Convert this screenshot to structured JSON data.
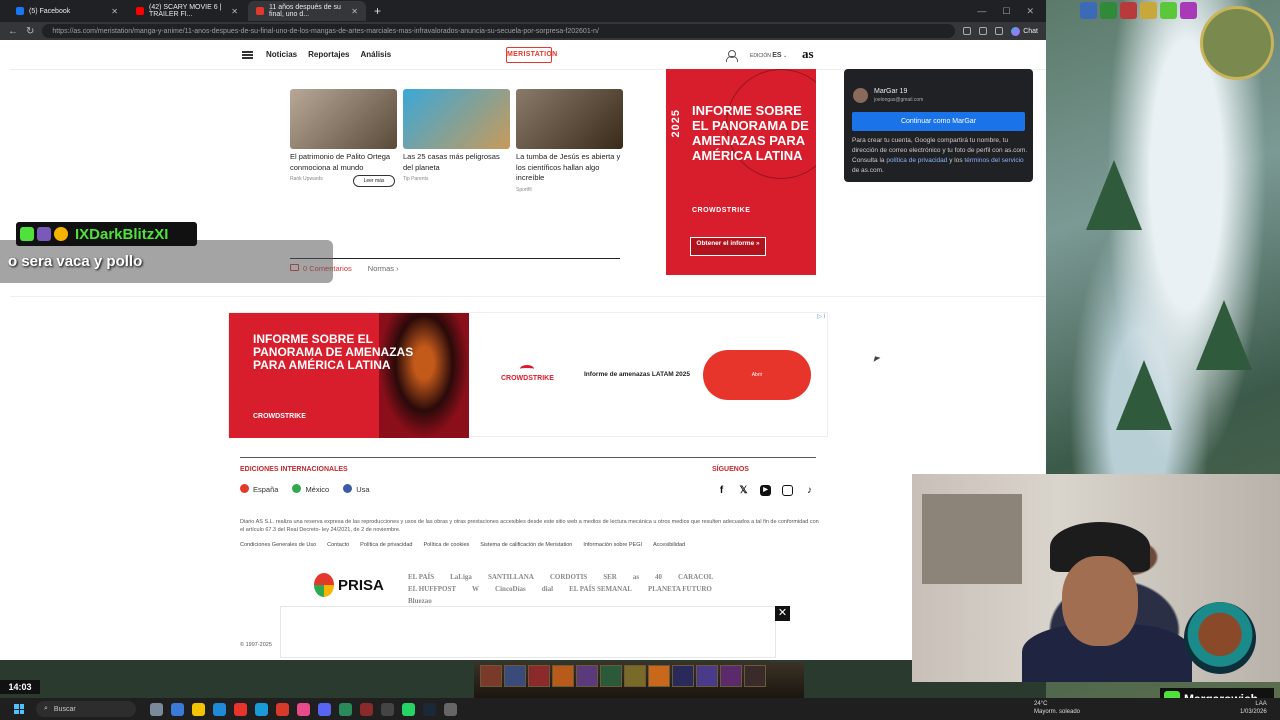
{
  "browser": {
    "tabs": [
      {
        "title": "(5) Facebook",
        "color": "#1877f2",
        "active": false
      },
      {
        "title": "(42) SCARY MOVIE 6 | TRAILER FI...",
        "color": "#ff0000",
        "active": false
      },
      {
        "title": "11 años después de su final, uno d...",
        "color": "#e4382b",
        "active": true
      }
    ],
    "new_tab": "+",
    "url": "https://as.com/meristation/manga-y-anime/11-anos-despues-de-su-final-uno-de-los-mangas-de-artes-marciales-mas-infravalorados-anuncia-su-secuela-por-sorpresa-f202601-n/",
    "copilot_label": "Chat"
  },
  "site": {
    "nav": [
      "Noticias",
      "Reportajes",
      "Análisis"
    ],
    "logo": "MERISTATION",
    "edition_label": "EDICIÓN",
    "edition_value": "ES",
    "as_logo": "as"
  },
  "related": [
    {
      "title": "El patrimonio de Palito Ortega conmociona al mundo",
      "source": "Rank Upwards",
      "img": "#8a7a6a"
    },
    {
      "title": "Las 25 casas más peligrosas del planeta",
      "source": "Tip Parents",
      "img": "#5aa8c8"
    },
    {
      "title": "La tumba de Jesús es abierta y los científicos hallan algo increíble",
      "source": "Sportfil",
      "img": "#7a6a5a"
    }
  ],
  "leer_mas": "Leer más",
  "comments": {
    "label": "0 Comentarios",
    "normas": "Normas ›"
  },
  "side_ad": {
    "year": "2025",
    "title": "INFORME SOBRE EL PANORAMA DE AMENAZAS PARA AMÉRICA LATINA",
    "brand": "CROWDSTRIKE",
    "button": "Obtener el informe »"
  },
  "google_onetap": {
    "name": "MarGar 19",
    "email": "joelongas@gmail.com",
    "continue": "Continuar como MarGar",
    "text_1": "Para crear tu cuenta, Google compartirá tu nombre, tu dirección de correo electrónico y tu foto de perfil con as.com. Consulta la ",
    "link_1": "política de privacidad",
    "text_2": " y los ",
    "link_2": "términos del servicio",
    "text_3": " de as.com."
  },
  "banner_ad": {
    "title": "INFORME SOBRE EL PANORAMA DE AMENAZAS PARA AMÉRICA LATINA",
    "brand": "CROWDSTRIKE",
    "mid_text": "Informe de amenazas LATAM 2025",
    "button": "Abrir",
    "adchoices": "▷ i"
  },
  "footer": {
    "ediciones_title": "EDICIONES INTERNACIONALES",
    "siguenos": "SÍGUENOS",
    "editions": [
      {
        "label": "España",
        "color": "#e4382b"
      },
      {
        "label": "México",
        "color": "#2fa84f"
      },
      {
        "label": "Usa",
        "color": "#3b5ba8"
      }
    ],
    "social": [
      "f",
      "𝕏",
      "▶",
      "◎",
      "♪"
    ],
    "legal": "Diario AS S.L. realiza una reserva expresa de las reproducciones y usos de las obras y otras prestaciones accesibles desde este sitio web a medios de lectura mecánica u otros medios que resulten adecuados a tal fin de conformidad con el artículo 67.3 del Real Decreto- ley 24/2021, de 2 de noviembre.",
    "links": [
      "Condiciones Generales de Uso",
      "Contacto",
      "Política de privacidad",
      "Política de cookies",
      "Sistema de calificación de Meristation",
      "Información sobre PEGI",
      "Accesibilidad"
    ],
    "prisa": "PRISA",
    "brands": [
      "EL PAÍS",
      "LaLiga",
      "SANTILLANA",
      "CORDOTIS",
      "SER",
      "as",
      "40",
      "CARACOL",
      "EL HUFFPOST",
      "W",
      "CincoDías",
      "dial",
      "EL PAÍS SEMANAL",
      "PLANETA FUTURO",
      "Bluezao"
    ],
    "copyright": "© 1997-2025"
  },
  "chat": {
    "username": "IXDarkBlitzXI",
    "message": "o sera vaca y pollo"
  },
  "streamer": {
    "name": "Margarowich"
  },
  "taskbar": {
    "search": "Buscar",
    "time_overlay": "14:03",
    "weather_temp": "24°C",
    "weather_desc": "Mayorm. soleado",
    "lang": "LAA",
    "date": "1/03/2026"
  }
}
